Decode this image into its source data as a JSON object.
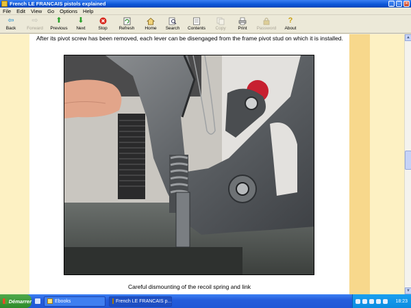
{
  "window": {
    "title": "French LE FRANCAIS pistols explained",
    "controls": {
      "minimize": "_",
      "maximize": "□",
      "close": "×"
    }
  },
  "menu": [
    "File",
    "Edit",
    "View",
    "Go",
    "Options",
    "Help"
  ],
  "toolbar": [
    {
      "label": "Back",
      "icon": "back-arrow-icon",
      "enabled": true
    },
    {
      "label": "Forward",
      "icon": "forward-arrow-icon",
      "enabled": false
    },
    {
      "label": "Previous",
      "icon": "up-arrow-icon",
      "enabled": true
    },
    {
      "label": "Next",
      "icon": "down-arrow-icon",
      "enabled": true
    },
    {
      "label": "Stop",
      "icon": "stop-icon",
      "enabled": true
    },
    {
      "label": "Refresh",
      "icon": "refresh-icon",
      "enabled": true
    },
    {
      "label": "Home",
      "icon": "home-icon",
      "enabled": true
    },
    {
      "label": "Search",
      "icon": "search-icon",
      "enabled": true
    },
    {
      "label": "Contents",
      "icon": "contents-icon",
      "enabled": true
    },
    {
      "label": "Copy",
      "icon": "copy-icon",
      "enabled": false
    },
    {
      "label": "Print",
      "icon": "print-icon",
      "enabled": true
    },
    {
      "label": "Password",
      "icon": "password-icon",
      "enabled": false
    },
    {
      "label": "About",
      "icon": "about-icon",
      "enabled": true
    }
  ],
  "page": {
    "intro_text": "After its pivot screw has been removed, each lever can be disengaged from the frame pivot stud on which it is installed.",
    "caption": "Careful dismounting of the recoil spring and link"
  },
  "taskbar": {
    "start_label": "Démarrer",
    "tasks": [
      {
        "label": "Ebooks",
        "active": false
      },
      {
        "label": "French LE FRANCAIS p...",
        "active": true
      }
    ],
    "clock": "18:23"
  },
  "colors": {
    "page_bg": "#ffffff",
    "margin_bg": "#fdf1c3",
    "band_bg": "#f7d88c",
    "titlebar": "#0a55d6"
  }
}
